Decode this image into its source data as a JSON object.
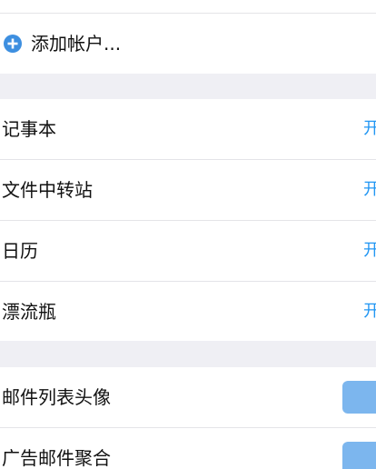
{
  "accounts": {
    "add_label": "添加帐户..."
  },
  "features": [
    {
      "label": "记事本",
      "value": "开"
    },
    {
      "label": "文件中转站",
      "value": "开"
    },
    {
      "label": "日历",
      "value": "开"
    },
    {
      "label": "漂流瓶",
      "value": "开"
    }
  ],
  "toggles": [
    {
      "label": "邮件列表头像"
    },
    {
      "label": "广告邮件聚合"
    }
  ],
  "colors": {
    "accent": "#2196f3",
    "background": "#efeff4",
    "toggle": "#7cb6ee"
  }
}
